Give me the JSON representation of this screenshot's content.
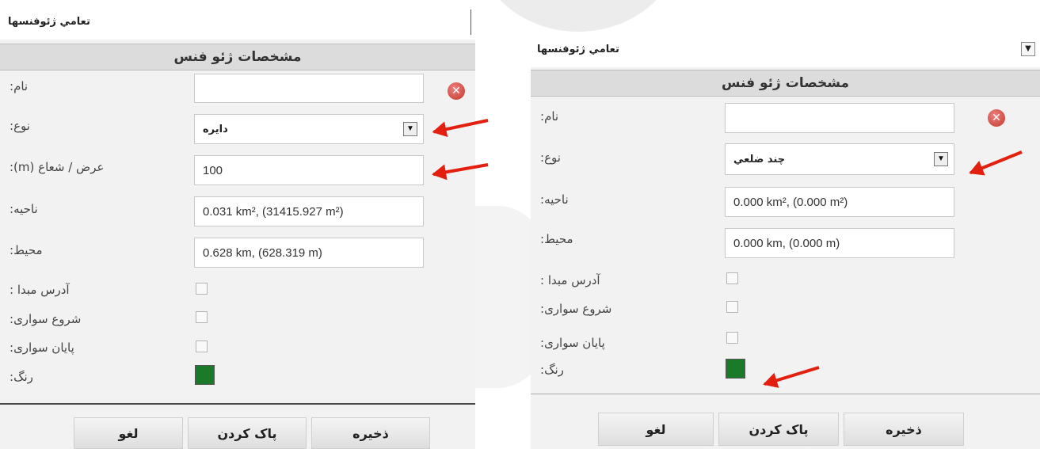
{
  "left_panel": {
    "window_title": "تعامي ژئوفنسها",
    "header": "مشخصات ژئو فنس",
    "labels": {
      "name": ":نام",
      "type": ":نوع",
      "radius": ":(m) عرض / شعاع",
      "area": ":ناحیه",
      "perimeter": ":محیط",
      "origin_address": ": آدرس مبدا",
      "ride_start": ":شروع سواری",
      "ride_end": ":پایان سواری",
      "color": ":رنگ"
    },
    "values": {
      "name": "",
      "type": "دایره",
      "radius": "100",
      "area": "0.031 km², (31415.927 m²)",
      "perimeter": "0.628 km, (628.319 m)"
    },
    "color_swatch": "#1b7a2a",
    "buttons": {
      "save": "ذخیره",
      "clear": "پاک کردن",
      "cancel": "لغو"
    }
  },
  "right_panel": {
    "window_title": "تعامي ژئوفنسها",
    "header": "مشخصات ژئو فنس",
    "labels": {
      "name": ":نام",
      "type": ":نوع",
      "area": ":ناحیه",
      "perimeter": ":محیط",
      "origin_address": ": آدرس مبدا",
      "ride_start": ":شروع سواری",
      "ride_end": ":پایان سواری",
      "color": ":رنگ"
    },
    "values": {
      "name": "",
      "type": "چند ضلعي",
      "area": "0.000 km², (0.000 m²)",
      "perimeter": "0.000 km, (0.000 m)"
    },
    "color_swatch": "#1b7a2a",
    "buttons": {
      "save": "ذخیره",
      "clear": "پاک کردن",
      "cancel": "لغو"
    }
  },
  "annotation_color": "#e32010",
  "icons": {
    "clear": "clear-icon",
    "dropdown": "chevron-down-icon"
  }
}
